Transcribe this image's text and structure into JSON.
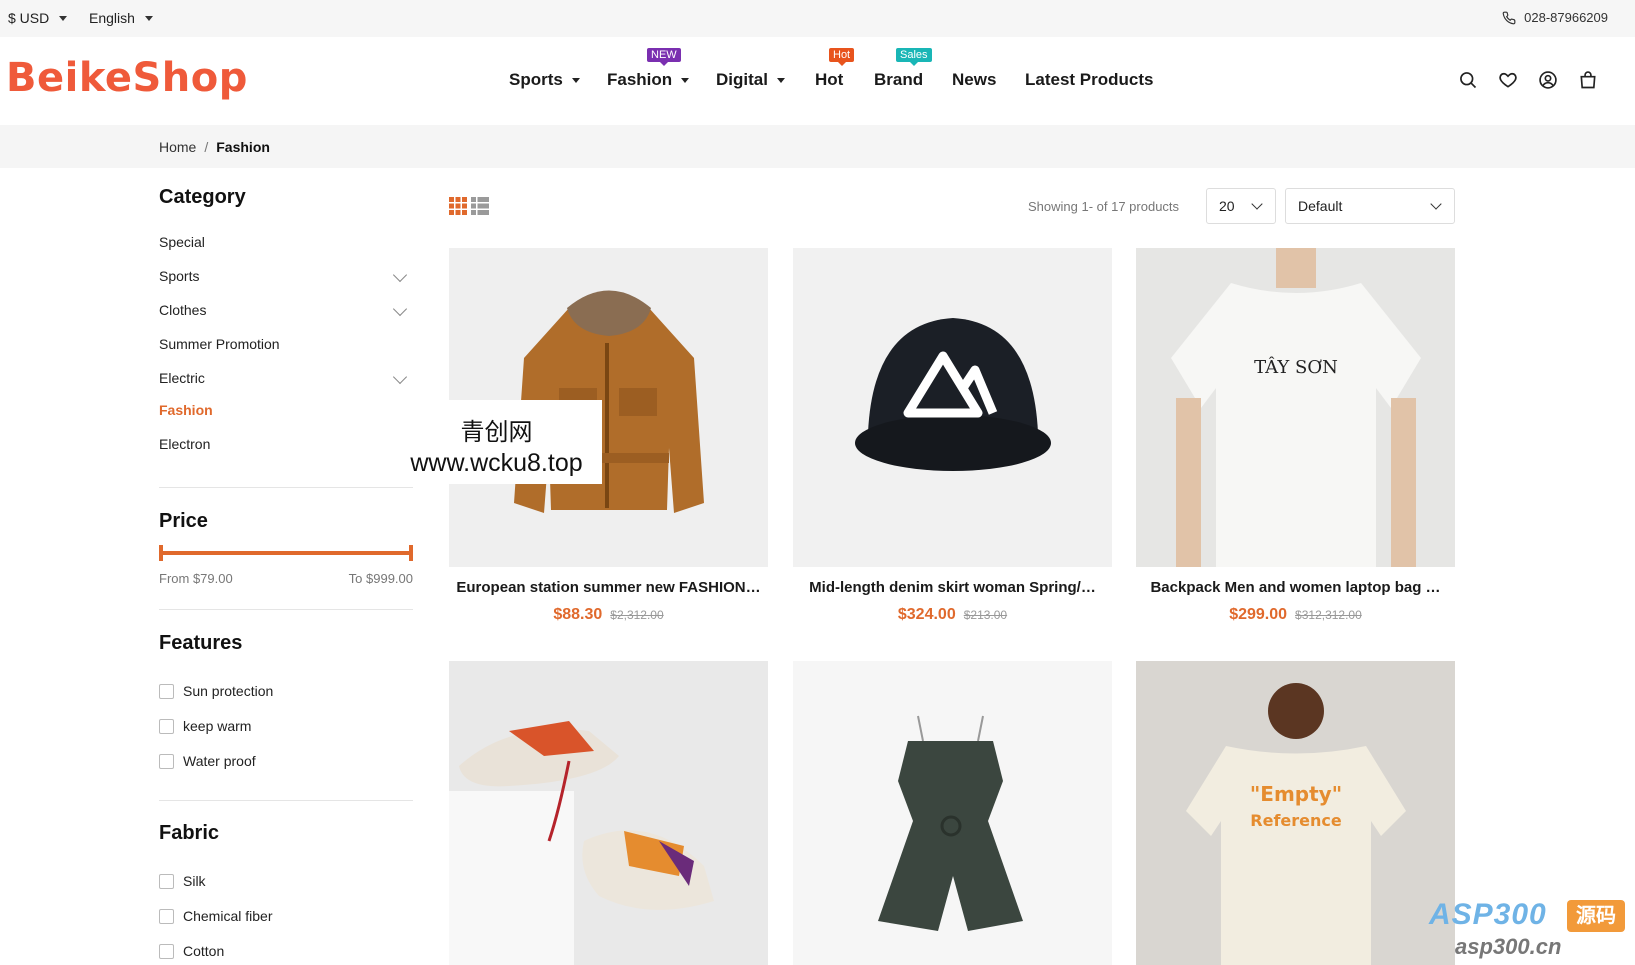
{
  "topbar": {
    "currency": "$ USD",
    "language": "English",
    "phone": "028-87966209"
  },
  "brand": {
    "logo": "BeikeShop",
    "accent": "#e0692c",
    "logo_color": "#ef5a3a"
  },
  "nav": {
    "items": [
      {
        "label": "Sports",
        "dropdown": true
      },
      {
        "label": "Fashion",
        "dropdown": true,
        "badge": "NEW",
        "badge_color": "#7a2fb0"
      },
      {
        "label": "Digital",
        "dropdown": true
      },
      {
        "label": "Hot",
        "dropdown": false,
        "badge": "Hot",
        "badge_color": "#e8541d"
      },
      {
        "label": "Brand",
        "dropdown": false,
        "badge": "Sales",
        "badge_color": "#19b6b6"
      },
      {
        "label": "News",
        "dropdown": false
      },
      {
        "label": "Latest Products",
        "dropdown": false
      }
    ],
    "icons": [
      "search-icon",
      "heart-icon",
      "account-icon",
      "cart-icon"
    ]
  },
  "breadcrumb": {
    "home": "Home",
    "separator": "/",
    "current": "Fashion"
  },
  "sidebar": {
    "category_title": "Category",
    "categories": [
      {
        "label": "Special",
        "expandable": false,
        "active": false
      },
      {
        "label": "Sports",
        "expandable": true,
        "active": false
      },
      {
        "label": "Clothes",
        "expandable": true,
        "active": false
      },
      {
        "label": "Summer Promotion",
        "expandable": false,
        "active": false
      },
      {
        "label": "Electric",
        "expandable": true,
        "active": false
      },
      {
        "label": "Fashion",
        "expandable": false,
        "active": true
      },
      {
        "label": "Electron",
        "expandable": false,
        "active": false
      }
    ],
    "price_title": "Price",
    "price_from": "From $79.00",
    "price_to": "To $999.00",
    "features_title": "Features",
    "features": [
      "Sun protection",
      "keep warm",
      "Water proof"
    ],
    "fabric_title": "Fabric",
    "fabric": [
      "Silk",
      "Chemical fiber",
      "Cotton"
    ]
  },
  "overlay": {
    "line1": "青创网",
    "line2": "www.wcku8.top"
  },
  "toolbar": {
    "showing": "Showing 1- of 17 products",
    "per_page": "20",
    "sort": "Default"
  },
  "products": [
    {
      "name": "European station summer new FASHION…",
      "price": "$88.30",
      "old_price": "$2,312.00",
      "image": "jacket"
    },
    {
      "name": "Mid-length denim skirt woman Spring/…",
      "price": "$324.00",
      "old_price": "$213.00",
      "image": "cap"
    },
    {
      "name": "Backpack Men and women laptop bag …",
      "price": "$299.00",
      "old_price": "$312,312.00",
      "image": "tshirt"
    },
    {
      "name": "",
      "price": "",
      "old_price": "",
      "image": "sneakers"
    },
    {
      "name": "",
      "price": "",
      "old_price": "",
      "image": "romper"
    },
    {
      "name": "",
      "price": "",
      "old_price": "",
      "image": "back-tshirt"
    }
  ],
  "watermark": {
    "logo": "ASP300",
    "badge": "源码",
    "url": "asp300.cn"
  }
}
